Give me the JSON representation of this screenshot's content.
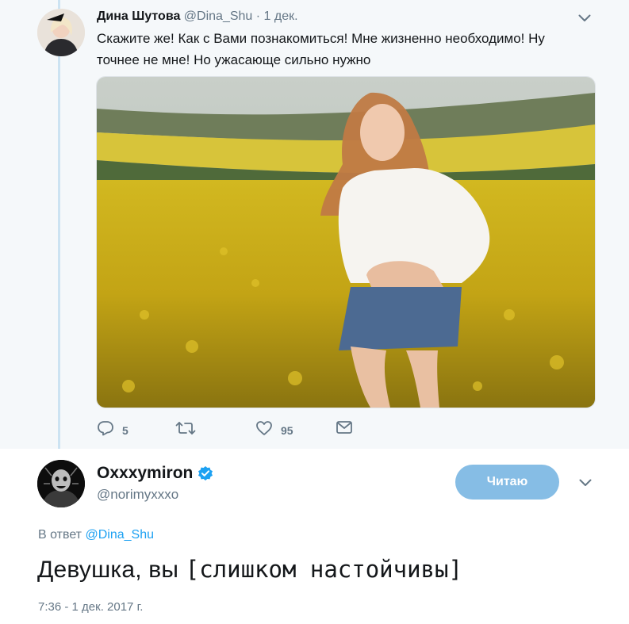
{
  "parent_tweet": {
    "author_name": "Дина Шутова",
    "handle": "@Dina_Shu",
    "separator": "·",
    "date": "1 дек.",
    "text": "Скажите же! Как с Вами познакомиться! Мне жизненно необходимо! Ну точнее не мне! Но ужасающе сильно нужно",
    "media_icon": "photo-girl-in-rapeseed-field",
    "actions": {
      "reply_count": "5",
      "retweet_count": "",
      "like_count": "95"
    }
  },
  "main_tweet": {
    "author_name": "Oxxxymiron",
    "verified": true,
    "handle": "@norimyxxxo",
    "follow_label": "Читаю",
    "reply_prefix": "В ответ",
    "reply_to": "@Dina_Shu",
    "text_plain": "Девушка, вы ",
    "text_mono": "[слишком настойчивы]",
    "timestamp": "7:36 - 1 дек. 2017 г."
  },
  "colors": {
    "accent": "#1da1f2",
    "follow_button": "#86bde5",
    "muted": "#657786",
    "thread_line": "#cce3f2",
    "parent_bg": "#f5f8fa"
  }
}
